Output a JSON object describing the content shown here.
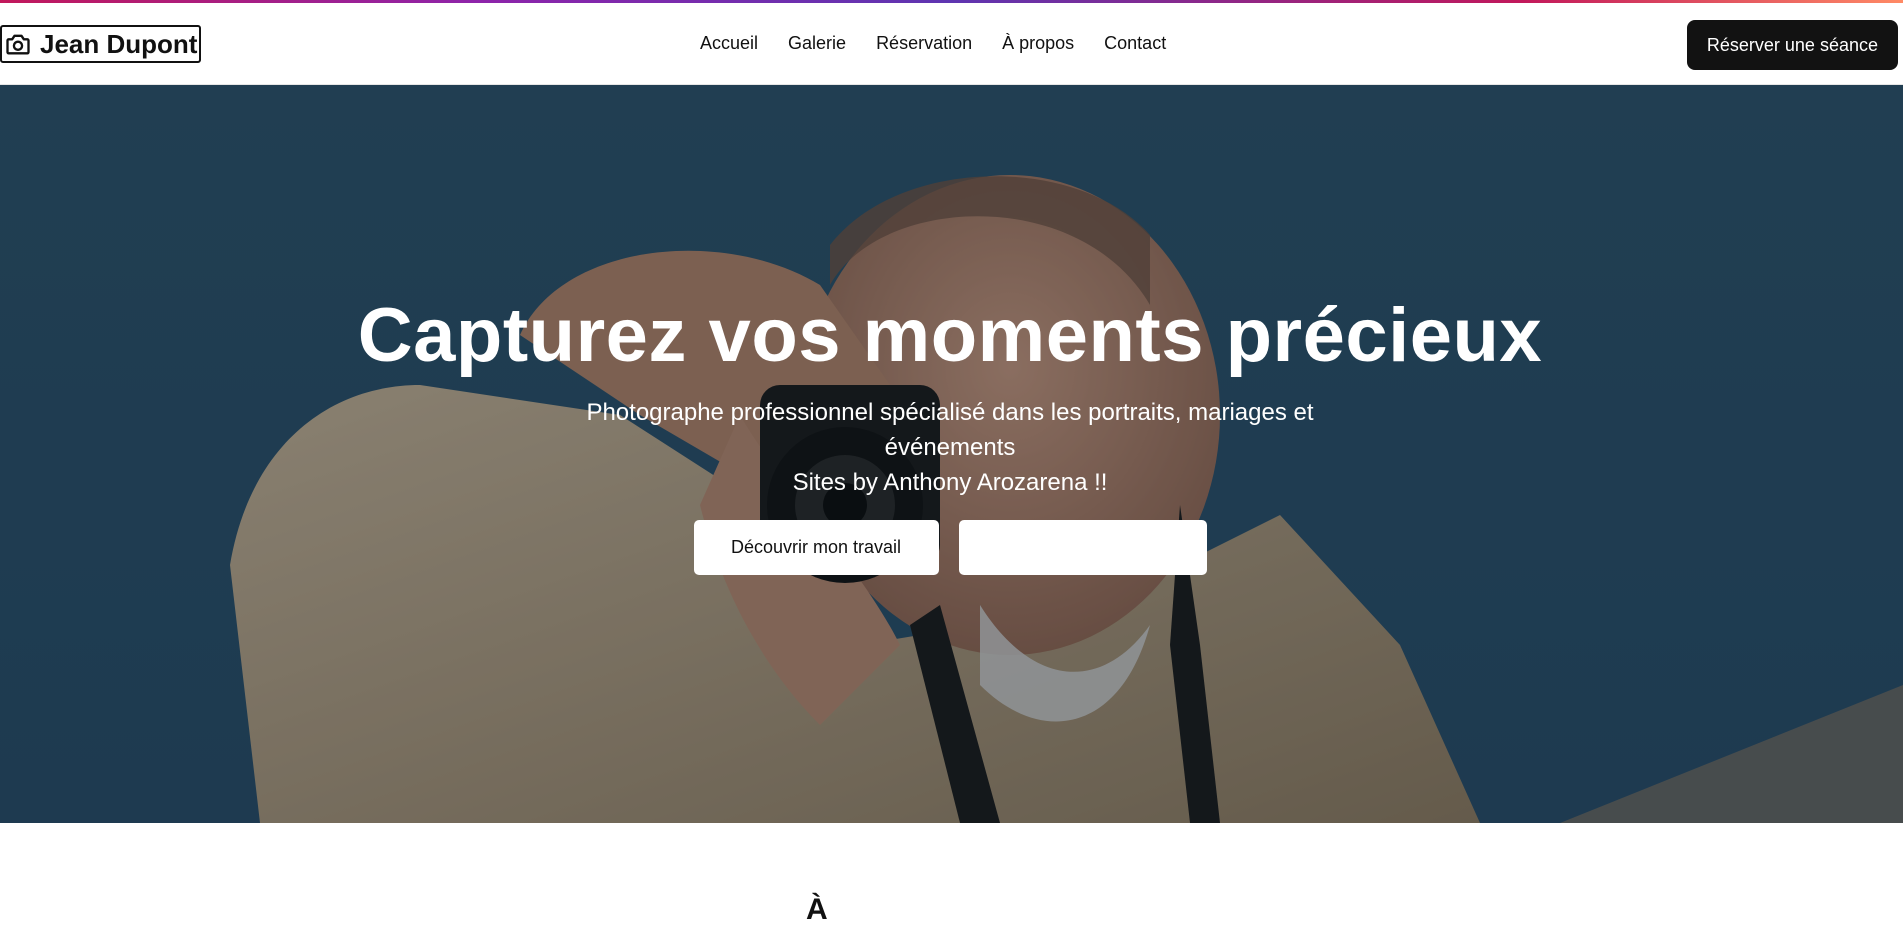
{
  "header": {
    "brand_name": "Jean Dupont",
    "brand_icon": "camera-icon",
    "nav": [
      {
        "label": "Accueil"
      },
      {
        "label": "Galerie"
      },
      {
        "label": "Réservation"
      },
      {
        "label": "À propos"
      },
      {
        "label": "Contact"
      }
    ],
    "cta_label": "Réserver une séance"
  },
  "hero": {
    "title": "Capturez vos moments précieux",
    "subtitle_line1": "Photographe professionnel spécialisé dans les portraits, mariages et événements",
    "subtitle_line2": "Sites by Anthony Arozarena !!",
    "primary_button": "Découvrir mon travail",
    "secondary_button": ""
  },
  "next_section": {
    "heading_partial": "À"
  },
  "colors": {
    "accent_gradient": [
      "#c2185b",
      "#8e24aa",
      "#5e35b1",
      "#ff8a65"
    ],
    "cta_bg": "#121212",
    "hero_bg": "#2c4f66"
  }
}
